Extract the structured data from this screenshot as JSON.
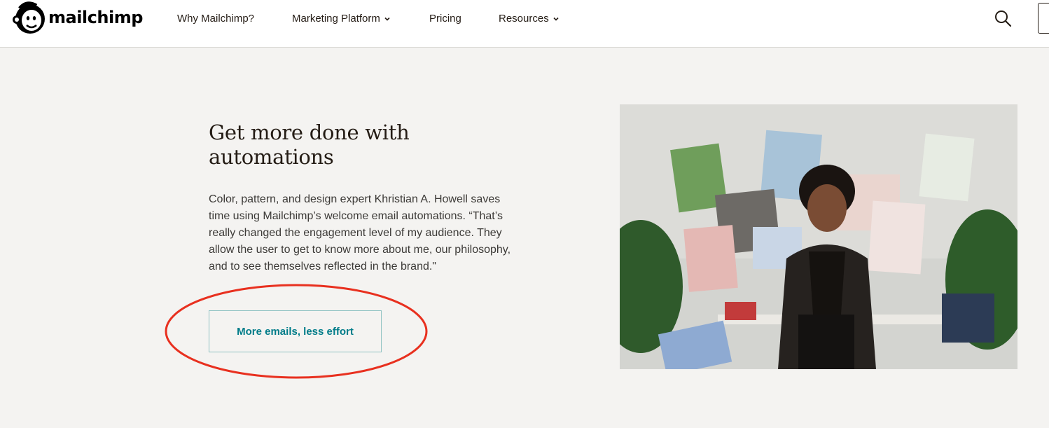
{
  "header": {
    "logo_text": "mailchimp",
    "nav": [
      {
        "label": "Why Mailchimp?",
        "has_dropdown": false
      },
      {
        "label": "Marketing Platform",
        "has_dropdown": true
      },
      {
        "label": "Pricing",
        "has_dropdown": false
      },
      {
        "label": "Resources",
        "has_dropdown": true
      }
    ],
    "icons": {
      "search": "search-icon",
      "dropdown": "chevron-down-icon",
      "logo": "freddie-chimp-icon"
    }
  },
  "feature": {
    "headline": "Get more done with automations",
    "body": "Color, pattern, and design expert Khristian A. Howell saves time using Mailchimp’s welcome email automations. “That’s really changed the engagement level of my audience. They allow the user to get to know more about me, our philosophy, and to see themselves reflected in the brand.\"",
    "cta_label": "More emails, less effort"
  },
  "colors": {
    "page_background": "#f4f3f1",
    "header_background": "#ffffff",
    "text": "#241c15",
    "cta_text": "#007c89",
    "cta_border": "#8fc2c2",
    "annotation": "#e8301f"
  }
}
